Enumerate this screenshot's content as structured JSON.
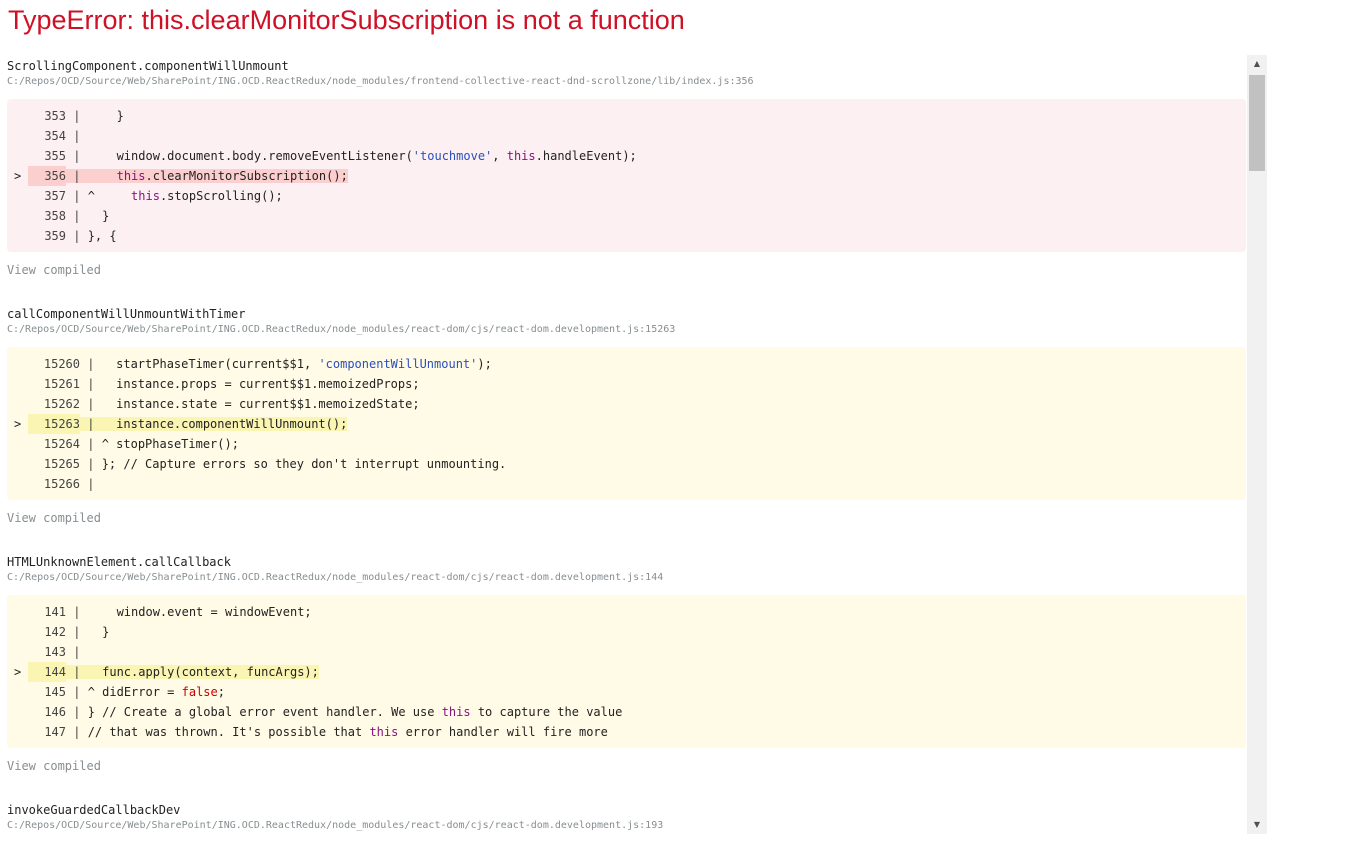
{
  "error": {
    "title": "TypeError: this.clearMonitorSubscription is not a function",
    "title_color": "#ce1126"
  },
  "frames": [
    {
      "function": "ScrollingComponent.componentWillUnmount",
      "path": "C:/Repos/OCD/Source/Web/SharePoint/ING.OCD.ReactRedux/node_modules/frontend-collective-react-dnd-scrollzone/lib/index.js:356",
      "block_type": "error",
      "lines": [
        {
          "num": "353",
          "code": "    }"
        },
        {
          "num": "354",
          "code": ""
        },
        {
          "num": "355",
          "code": "    window.document.body.removeEventListener('touchmove', this.handleEvent);"
        },
        {
          "num": "356",
          "code": "    this.clearMonitorSubscription();",
          "highlighted": true
        },
        {
          "num": "357",
          "code": "    this.stopScrolling();",
          "caret": true
        },
        {
          "num": "358",
          "code": "  }"
        },
        {
          "num": "359",
          "code": "}, {"
        }
      ],
      "view_compiled": "View compiled"
    },
    {
      "function": "callComponentWillUnmountWithTimer",
      "path": "C:/Repos/OCD/Source/Web/SharePoint/ING.OCD.ReactRedux/node_modules/react-dom/cjs/react-dom.development.js:15263",
      "block_type": "warn",
      "lines": [
        {
          "num": "15260",
          "code": "  startPhaseTimer(current$$1, 'componentWillUnmount');"
        },
        {
          "num": "15261",
          "code": "  instance.props = current$$1.memoizedProps;"
        },
        {
          "num": "15262",
          "code": "  instance.state = current$$1.memoizedState;"
        },
        {
          "num": "15263",
          "code": "  instance.componentWillUnmount();",
          "highlighted": true
        },
        {
          "num": "15264",
          "code": "stopPhaseTimer();",
          "caret": true
        },
        {
          "num": "15265",
          "code": "}; // Capture errors so they don't interrupt unmounting."
        },
        {
          "num": "15266",
          "code": ""
        }
      ],
      "view_compiled": "View compiled"
    },
    {
      "function": "HTMLUnknownElement.callCallback",
      "path": "C:/Repos/OCD/Source/Web/SharePoint/ING.OCD.ReactRedux/node_modules/react-dom/cjs/react-dom.development.js:144",
      "block_type": "warn",
      "lines": [
        {
          "num": "141",
          "code": "    window.event = windowEvent;"
        },
        {
          "num": "142",
          "code": "  }"
        },
        {
          "num": "143",
          "code": ""
        },
        {
          "num": "144",
          "code": "  func.apply(context, funcArgs);",
          "highlighted": true
        },
        {
          "num": "145",
          "code": "didError = false;",
          "caret": true
        },
        {
          "num": "146",
          "code": "} // Create a global error event handler. We use this to capture the value"
        },
        {
          "num": "147",
          "code": "// that was thrown. It's possible that this error handler will fire more"
        }
      ],
      "view_compiled": "View compiled"
    },
    {
      "function": "invokeGuardedCallbackDev",
      "path": "C:/Repos/OCD/Source/Web/SharePoint/ING.OCD.ReactRedux/node_modules/react-dom/cjs/react-dom.development.js:193"
    }
  ],
  "symbols": {
    "current_marker": ">",
    "separator": "|",
    "caret": "^"
  },
  "scrollbar": {
    "up_icon": "triangle-up",
    "down_icon": "triangle-down",
    "position_percent": 0
  },
  "colors": {
    "error_bg": "#fcf0f2",
    "error_highlight": "#fccfcf",
    "warn_bg": "#fffbe6",
    "warn_highlight": "#fbf5b4",
    "string": "#2b4fbd",
    "keyword": "#881280",
    "literal": "#c80000",
    "path": "#878e91"
  }
}
